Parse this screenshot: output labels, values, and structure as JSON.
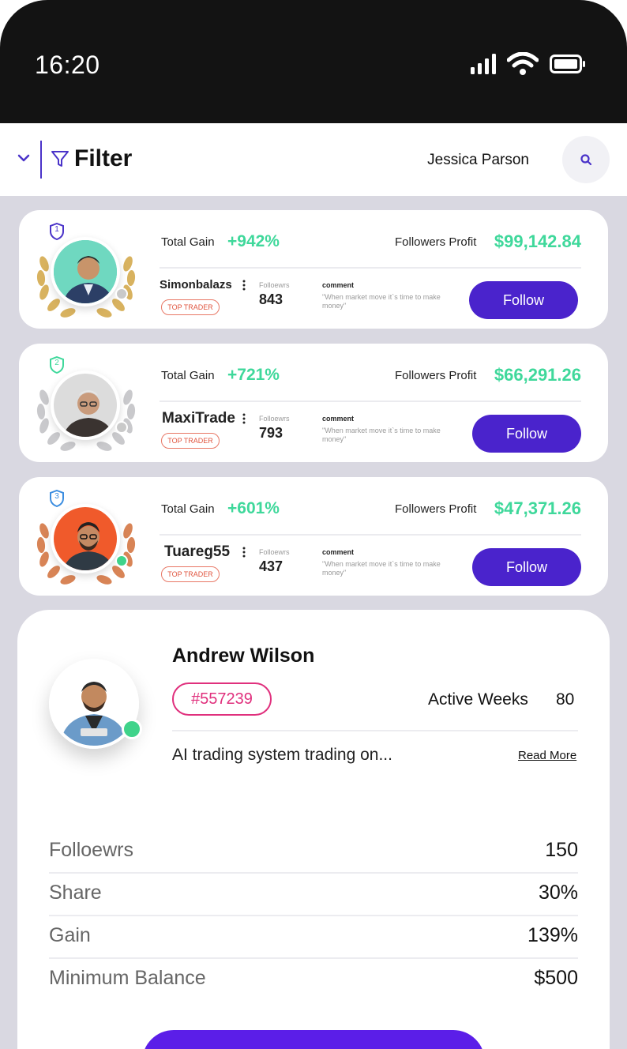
{
  "status_bar": {
    "time": "16:20"
  },
  "header": {
    "filter_label": "Filter",
    "user_name": "Jessica Parson"
  },
  "colors": {
    "accent": "#4a23cc",
    "gain": "#3fd89b",
    "id_pink": "#e0307d",
    "online": "#3fd38a"
  },
  "traders": [
    {
      "rank": "1",
      "total_gain_label": "Total Gain",
      "total_gain": "+942%",
      "followers_profit_label": "Followers Profit",
      "followers_profit": "$99,142.84",
      "name": "Simonbalazs",
      "badge": "TOP TRADER",
      "followers_label": "Folloewrs",
      "followers": "843",
      "comment_label": "comment",
      "comment": "\"When market move it`s time to make money\"",
      "follow_label": "Follow",
      "laurel": "gold",
      "status": "offline"
    },
    {
      "rank": "2",
      "total_gain_label": "Total Gain",
      "total_gain": "+721%",
      "followers_profit_label": "Followers Profit",
      "followers_profit": "$66,291.26",
      "name": "MaxiTrade",
      "badge": "TOP TRADER",
      "followers_label": "Folloewrs",
      "followers": "793",
      "comment_label": "comment",
      "comment": "\"When market move it`s time to make money\"",
      "follow_label": "Follow",
      "laurel": "silver",
      "status": "offline"
    },
    {
      "rank": "3",
      "total_gain_label": "Total Gain",
      "total_gain": "+601%",
      "followers_profit_label": "Followers Profit",
      "followers_profit": "$47,371.26",
      "name": "Tuareg55",
      "badge": "TOP TRADER",
      "followers_label": "Folloewrs",
      "followers": "437",
      "comment_label": "comment",
      "comment": "\"When market move it`s time to make money\"",
      "follow_label": "Follow",
      "laurel": "bronze",
      "status": "online"
    }
  ],
  "detail": {
    "name": "Andrew Wilson",
    "id": "#557239",
    "active_weeks_label": "Active Weeks",
    "active_weeks": "80",
    "description": "AI trading system trading on...",
    "read_more": "Read More",
    "stats": [
      {
        "label": "Folloewrs",
        "value": "150"
      },
      {
        "label": "Share",
        "value": "30%"
      },
      {
        "label": "Gain",
        "value": "139%"
      },
      {
        "label": "Minimum Balance",
        "value": "$500"
      }
    ]
  }
}
